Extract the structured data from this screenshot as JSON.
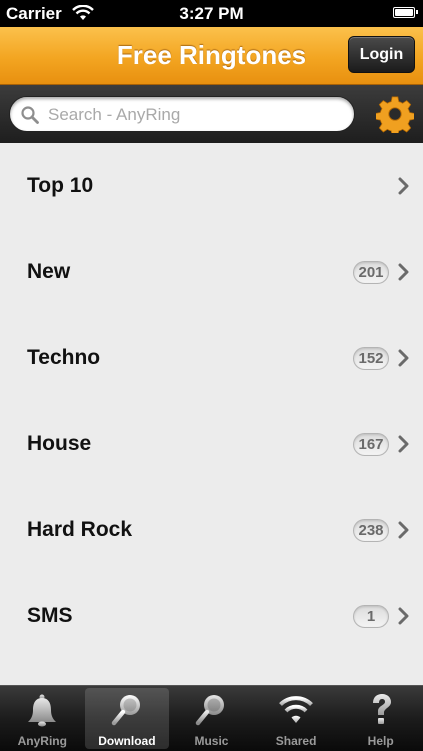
{
  "status_bar": {
    "carrier": "Carrier",
    "time": "3:27 PM"
  },
  "nav": {
    "title": "Free Ringtones",
    "login_label": "Login"
  },
  "search": {
    "placeholder": "Search - AnyRing",
    "value": ""
  },
  "list": {
    "items": [
      {
        "label": "Top 10",
        "count": ""
      },
      {
        "label": "New",
        "count": "201"
      },
      {
        "label": "Techno",
        "count": "152"
      },
      {
        "label": "House",
        "count": "167"
      },
      {
        "label": "Hard Rock",
        "count": "238"
      },
      {
        "label": "SMS",
        "count": "1"
      }
    ]
  },
  "tab_bar": {
    "tabs": [
      {
        "label": "AnyRing",
        "icon": "bell-icon",
        "selected": false
      },
      {
        "label": "Download",
        "icon": "search-icon",
        "selected": true
      },
      {
        "label": "Music",
        "icon": "search-icon",
        "selected": false
      },
      {
        "label": "Shared",
        "icon": "wifi-icon",
        "selected": false
      },
      {
        "label": "Help",
        "icon": "question-icon",
        "selected": false
      }
    ]
  },
  "colors": {
    "nav_orange": "#f3a521",
    "gear_orange": "#f0a020",
    "background": "#ececec"
  }
}
